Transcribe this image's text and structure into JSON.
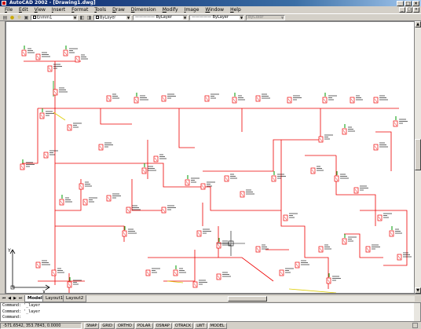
{
  "window": {
    "title": "AutoCAD 2002 - [Drawing1.dwg]",
    "controls": [
      "_",
      "□",
      "×"
    ],
    "doc_controls": [
      "_",
      "□",
      "×"
    ]
  },
  "menu": [
    "File",
    "Edit",
    "View",
    "Insert",
    "Format",
    "Tools",
    "Draw",
    "Dimension",
    "Modify",
    "Image",
    "Window",
    "Help"
  ],
  "toolbar": {
    "layer": "Enmm1",
    "color": "ByLayer",
    "linetype": "ByLayer",
    "lineweight": "ByLayer",
    "plotstyle": "ByColor"
  },
  "layout_tabs": [
    "Model",
    "Layout1",
    "Layout2"
  ],
  "active_tab": "Model",
  "command_lines": [
    "Command: '_layer",
    "Command: '_layer",
    "Command:"
  ],
  "status": {
    "coordinates": "-571.6542, 353.7843, 0.0000",
    "modes": [
      "SNAP",
      "GRID",
      "ORTHO",
      "POLAR",
      "OSNAP",
      "OTRACK",
      "LWT",
      "MODEL"
    ]
  },
  "ucs_icon": {
    "x_label": "X",
    "y_label": "Y"
  },
  "colors": {
    "wire": "#ee0000",
    "accent_green": "#009900",
    "accent_yellow": "#ddcc00",
    "title_bar": "#0a246a"
  }
}
